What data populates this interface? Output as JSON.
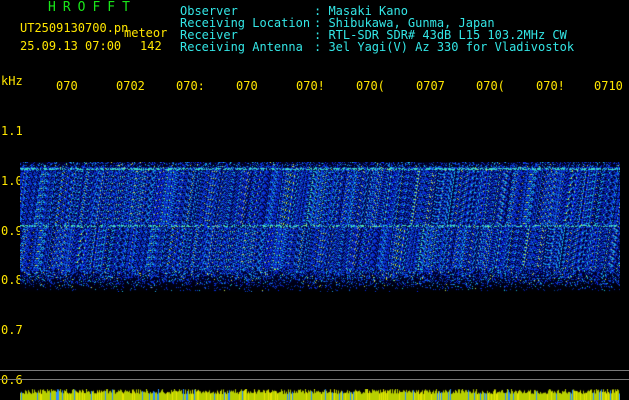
{
  "header": {
    "brand": "HROFFT",
    "file": "UT2509130700.pn",
    "mode": "meteor",
    "datetime": "25.09.13 07:00",
    "count": "142",
    "labels": {
      "observer": "Observer",
      "location": "Receiving Location",
      "receiver": "Receiver",
      "antenna": "Receiving Antenna"
    },
    "values": {
      "observer": ": Masaki Kano",
      "location": ": Shibukawa, Gunma, Japan",
      "receiver": ": RTL-SDR SDR# 43dB L15 103.2MHz CW",
      "antenna": ": 3el Yagi(V) Az 330 for Vladivostok"
    }
  },
  "axis": {
    "unit": "kHz",
    "y_ticks": [
      "1.1",
      "1.0",
      "0.9",
      "0.8",
      "0.7",
      "0.6"
    ],
    "time_ticks": [
      "070",
      "0702",
      "070:",
      "070",
      "070!",
      "070(",
      "0707",
      "070(",
      "070!",
      "0710"
    ]
  },
  "colors": {
    "background": "#000000",
    "label_text": "#ffe600",
    "header_text": "#33e6e6",
    "brand_text": "#19e619",
    "signal_band": "#1e3cff"
  }
}
